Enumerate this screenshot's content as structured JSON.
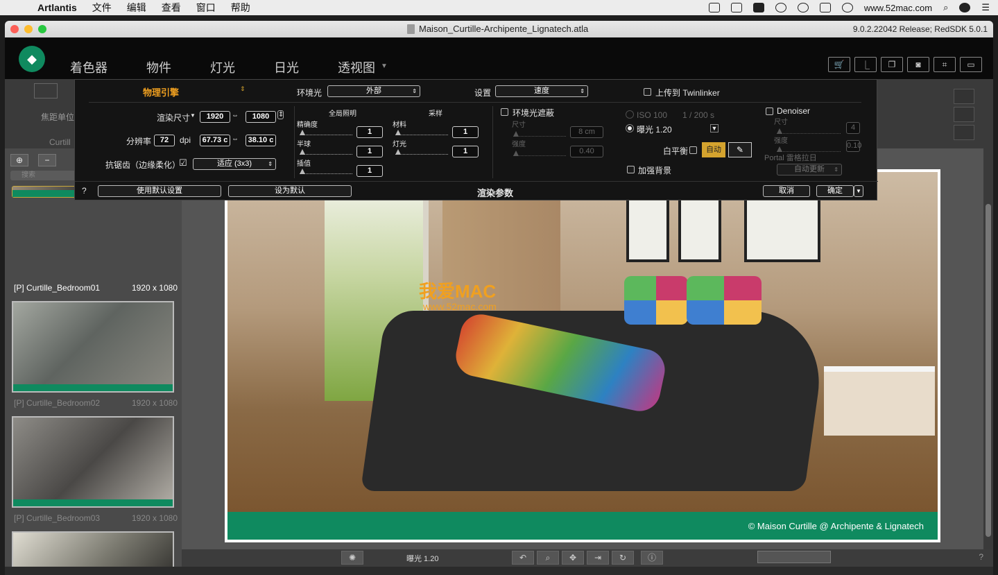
{
  "menubar": {
    "app": "Artlantis",
    "items": [
      "文件",
      "编辑",
      "查看",
      "窗口",
      "帮助"
    ],
    "site": "www.52mac.com"
  },
  "window": {
    "title": "Maison_Curtille-Archipente_Lignatech.atla",
    "version": "9.0.2.22042 Release; RedSDK 5.0.1"
  },
  "tabs": [
    "着色器",
    "物件",
    "灯光",
    "日光",
    "透视图"
  ],
  "camera": {
    "focal_label": "焦距单位",
    "curt": "Curtill"
  },
  "left": {
    "search_placeholder": "搜索",
    "thumbs": [
      {
        "name": "[P] Curtille_Bedroom01",
        "size": "1920 x 1080"
      },
      {
        "name": "[P] Curtille_Bedroom02",
        "size": "1920 x 1080"
      },
      {
        "name": "[P] Curtille_Bedroom03",
        "size": "1920 x 1080"
      }
    ]
  },
  "render": {
    "watermark1": "我爱MAC",
    "watermark2": "www.52mac.com",
    "copyright": "© Maison Curtille @ Archipente & Lignatech"
  },
  "bottom": {
    "exposure": "曝光 1.20"
  },
  "dialog": {
    "engine": "物理引擎",
    "env_label": "环境光",
    "env_value": "外部",
    "settings_label": "设置",
    "settings_value": "速度",
    "upload": "上传到 Twinlinker",
    "size_label": "渲染尺寸",
    "width": "1920",
    "height": "1080",
    "res_label": "分辨率",
    "dpi": "72",
    "dpi_unit": "dpi",
    "print_w": "67.73 c",
    "print_h": "38.10 c",
    "aa_label": "抗锯齿（边缘柔化）",
    "aa_value": "适应 (3x3)",
    "gi_title": "全局照明",
    "gi_precision": "精确度",
    "gi_precision_val": "1",
    "gi_hemi": "半球",
    "gi_hemi_val": "1",
    "gi_interp": "插值",
    "gi_interp_val": "1",
    "samp_title": "采样",
    "samp_mat": "材料",
    "samp_mat_val": "1",
    "samp_light": "灯光",
    "samp_light_val": "1",
    "ao_label": "环境光遮蔽",
    "ao_size": "尺寸",
    "ao_size_val": "8 cm",
    "ao_strength": "强度",
    "ao_strength_val": "0.40",
    "iso": "ISO 100",
    "shutter": "1 / 200 s",
    "exposure": "曝光 1.20",
    "wb_label": "白平衡",
    "wb_auto": "自动",
    "bg_boost": "加强背景",
    "denoiser": "Denoiser",
    "dn_size": "尺寸",
    "dn_size_val": "4",
    "dn_strength": "强度",
    "dn_strength_val": "0.10",
    "portal": "Portal 雷格拉日",
    "portal_value": "自动更新",
    "use_default": "使用默认设置",
    "set_default": "设为默认",
    "footer_title": "渲染参数",
    "cancel": "取消",
    "ok": "确定",
    "help": "?"
  }
}
